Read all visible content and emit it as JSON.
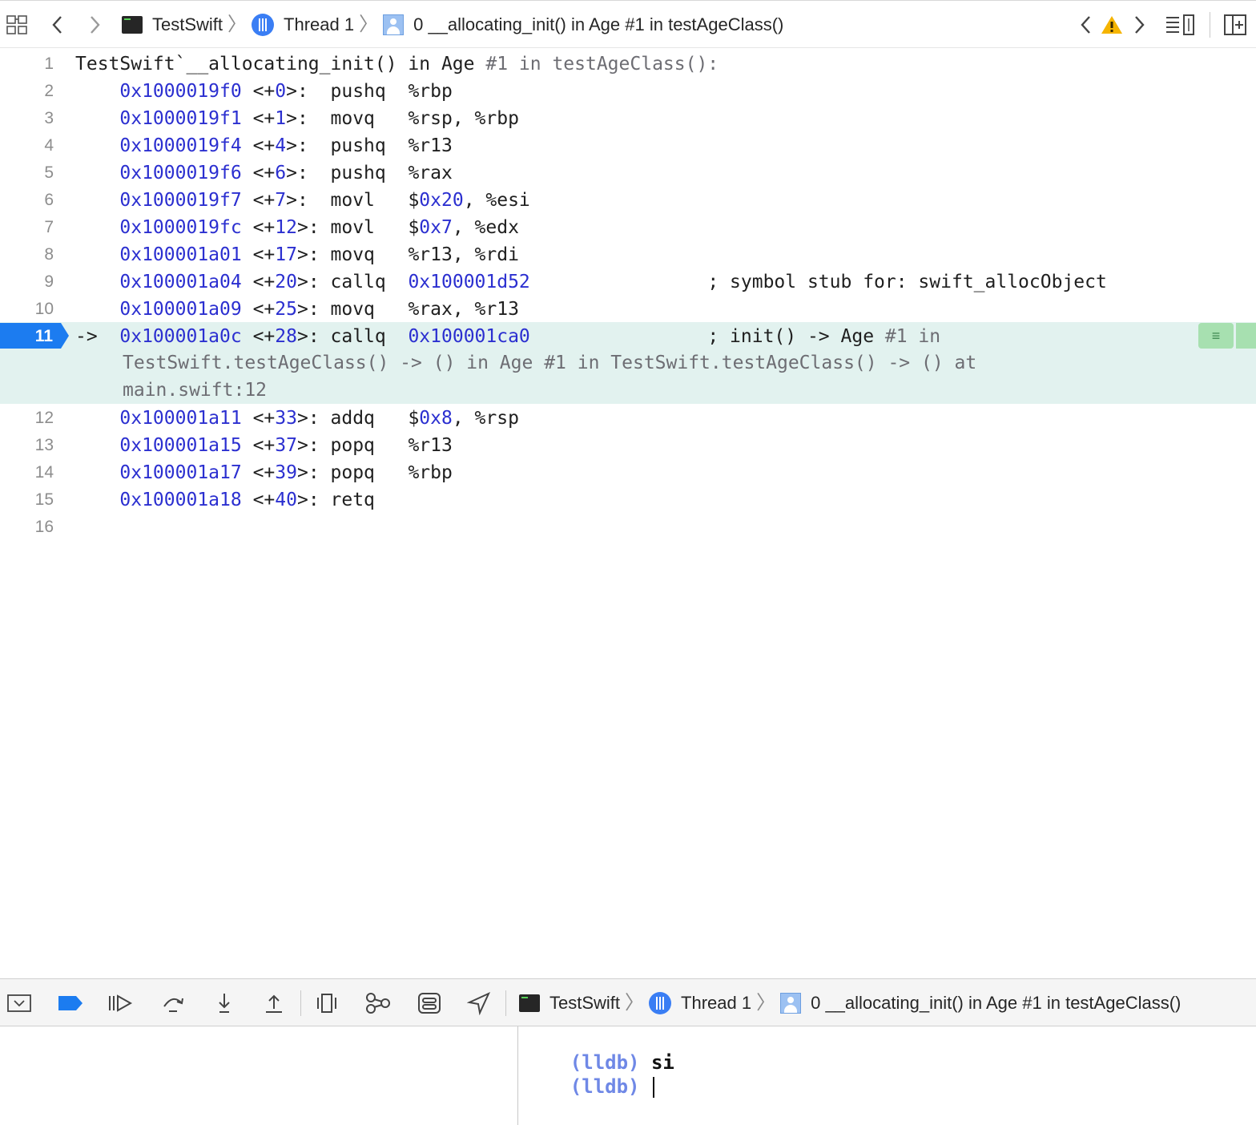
{
  "jump_bar": {
    "target": "TestSwift",
    "thread": "Thread 1",
    "frame": "0 __allocating_init() in Age #1 in testAgeClass()"
  },
  "editor": {
    "lines": [
      {
        "n": "1",
        "parts": [
          {
            "t": "TestSwift`__allocating_init() in Age ",
            "c": ""
          },
          {
            "t": "#1 in testAgeClass():",
            "c": "gray"
          }
        ]
      },
      {
        "n": "2",
        "parts": [
          {
            "t": "    ",
            "c": ""
          },
          {
            "t": "0x1000019f0",
            "c": "addr"
          },
          {
            "t": " <+",
            "c": ""
          },
          {
            "t": "0",
            "c": "num"
          },
          {
            "t": ">:  pushq  %rbp",
            "c": ""
          }
        ]
      },
      {
        "n": "3",
        "parts": [
          {
            "t": "    ",
            "c": ""
          },
          {
            "t": "0x1000019f1",
            "c": "addr"
          },
          {
            "t": " <+",
            "c": ""
          },
          {
            "t": "1",
            "c": "num"
          },
          {
            "t": ">:  movq   %rsp, %rbp",
            "c": ""
          }
        ]
      },
      {
        "n": "4",
        "parts": [
          {
            "t": "    ",
            "c": ""
          },
          {
            "t": "0x1000019f4",
            "c": "addr"
          },
          {
            "t": " <+",
            "c": ""
          },
          {
            "t": "4",
            "c": "num"
          },
          {
            "t": ">:  pushq  %r13",
            "c": ""
          }
        ]
      },
      {
        "n": "5",
        "parts": [
          {
            "t": "    ",
            "c": ""
          },
          {
            "t": "0x1000019f6",
            "c": "addr"
          },
          {
            "t": " <+",
            "c": ""
          },
          {
            "t": "6",
            "c": "num"
          },
          {
            "t": ">:  pushq  %rax",
            "c": ""
          }
        ]
      },
      {
        "n": "6",
        "parts": [
          {
            "t": "    ",
            "c": ""
          },
          {
            "t": "0x1000019f7",
            "c": "addr"
          },
          {
            "t": " <+",
            "c": ""
          },
          {
            "t": "7",
            "c": "num"
          },
          {
            "t": ">:  movl   $",
            "c": ""
          },
          {
            "t": "0x20",
            "c": "num"
          },
          {
            "t": ", %esi",
            "c": ""
          }
        ]
      },
      {
        "n": "7",
        "parts": [
          {
            "t": "    ",
            "c": ""
          },
          {
            "t": "0x1000019fc",
            "c": "addr"
          },
          {
            "t": " <+",
            "c": ""
          },
          {
            "t": "12",
            "c": "num"
          },
          {
            "t": ">: movl   $",
            "c": ""
          },
          {
            "t": "0x7",
            "c": "num"
          },
          {
            "t": ", %edx",
            "c": ""
          }
        ]
      },
      {
        "n": "8",
        "parts": [
          {
            "t": "    ",
            "c": ""
          },
          {
            "t": "0x100001a01",
            "c": "addr"
          },
          {
            "t": " <+",
            "c": ""
          },
          {
            "t": "17",
            "c": "num"
          },
          {
            "t": ">: movq   %r13, %rdi",
            "c": ""
          }
        ]
      },
      {
        "n": "9",
        "parts": [
          {
            "t": "    ",
            "c": ""
          },
          {
            "t": "0x100001a04",
            "c": "addr"
          },
          {
            "t": " <+",
            "c": ""
          },
          {
            "t": "20",
            "c": "num"
          },
          {
            "t": ">: callq  ",
            "c": ""
          },
          {
            "t": "0x100001d52",
            "c": "num"
          },
          {
            "t": "                ; symbol stub for: swift_allocObject",
            "c": ""
          }
        ]
      },
      {
        "n": "10",
        "parts": [
          {
            "t": "    ",
            "c": ""
          },
          {
            "t": "0x100001a09",
            "c": "addr"
          },
          {
            "t": " <+",
            "c": ""
          },
          {
            "t": "25",
            "c": "num"
          },
          {
            "t": ">: movq   %rax, %r13",
            "c": ""
          }
        ]
      },
      {
        "n": "11",
        "parts": [
          {
            "t": "->  ",
            "c": ""
          },
          {
            "t": "0x100001a0c",
            "c": "addr"
          },
          {
            "t": " <+",
            "c": ""
          },
          {
            "t": "28",
            "c": "num"
          },
          {
            "t": ">: callq  ",
            "c": ""
          },
          {
            "t": "0x100001ca0",
            "c": "num"
          },
          {
            "t": "                ; init() -> Age ",
            "c": ""
          },
          {
            "t": "#1 in",
            "c": "gray"
          }
        ]
      },
      {
        "n": "12",
        "parts": [
          {
            "t": "    ",
            "c": ""
          },
          {
            "t": "0x100001a11",
            "c": "addr"
          },
          {
            "t": " <+",
            "c": ""
          },
          {
            "t": "33",
            "c": "num"
          },
          {
            "t": ">: addq   $",
            "c": ""
          },
          {
            "t": "0x8",
            "c": "num"
          },
          {
            "t": ", %rsp",
            "c": ""
          }
        ]
      },
      {
        "n": "13",
        "parts": [
          {
            "t": "    ",
            "c": ""
          },
          {
            "t": "0x100001a15",
            "c": "addr"
          },
          {
            "t": " <+",
            "c": ""
          },
          {
            "t": "37",
            "c": "num"
          },
          {
            "t": ">: popq   %r13",
            "c": ""
          }
        ]
      },
      {
        "n": "14",
        "parts": [
          {
            "t": "    ",
            "c": ""
          },
          {
            "t": "0x100001a17",
            "c": "addr"
          },
          {
            "t": " <+",
            "c": ""
          },
          {
            "t": "39",
            "c": "num"
          },
          {
            "t": ">: popq   %rbp",
            "c": ""
          }
        ]
      },
      {
        "n": "15",
        "parts": [
          {
            "t": "    ",
            "c": ""
          },
          {
            "t": "0x100001a18",
            "c": "addr"
          },
          {
            "t": " <+",
            "c": ""
          },
          {
            "t": "40",
            "c": "num"
          },
          {
            "t": ">: retq",
            "c": ""
          }
        ]
      },
      {
        "n": "16",
        "parts": []
      }
    ],
    "current_line_continuation": [
      "TestSwift.testAgeClass() -> () in Age #1 in TestSwift.testAgeClass() -> () at",
      "main.swift:12"
    ]
  },
  "debug_bar": {
    "target": "TestSwift",
    "thread": "Thread 1",
    "frame": "0 __allocating_init() in Age #1 in testAgeClass()"
  },
  "console": {
    "history": [
      {
        "prompt": "(lldb)",
        "command": "si"
      }
    ],
    "current_prompt": "(lldb)"
  },
  "colors": {
    "address": "#2b2fd0",
    "breakpoint": "#1c7cf0",
    "highlight": "#e2f2ef",
    "warning": "#f5b400",
    "thread": "#3a7ef4"
  }
}
